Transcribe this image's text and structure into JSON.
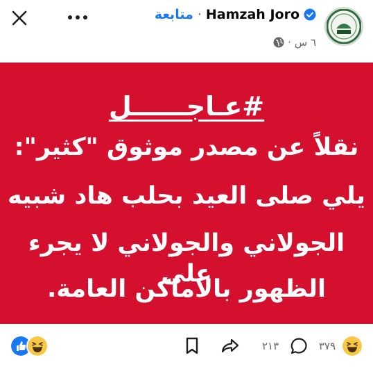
{
  "post": {
    "author": "Hamzah Joro",
    "follow_label": "متابعة",
    "dot": "·",
    "time": "٦ س",
    "meta_dot": "·",
    "audience_icon": "globe-icon",
    "avatar_text": "نادي"
  },
  "banner": {
    "background": "#d5102f",
    "headline": "#عـاجــــــل",
    "lines": [
      "نقلاً عن مصدر موثوق \"كثير\":",
      "يلي صلى العيد بحلب هاد شبيه",
      "الجولاني والجولاني لا يجرء على",
      "الظهور بالاماكن العامة."
    ]
  },
  "actions": {
    "reaction_count": "٣٧٩",
    "comment_count": "٢١٣",
    "icons": [
      "haha-icon",
      "comment-icon",
      "share-icon",
      "bookmark-icon",
      "like-icon"
    ]
  }
}
